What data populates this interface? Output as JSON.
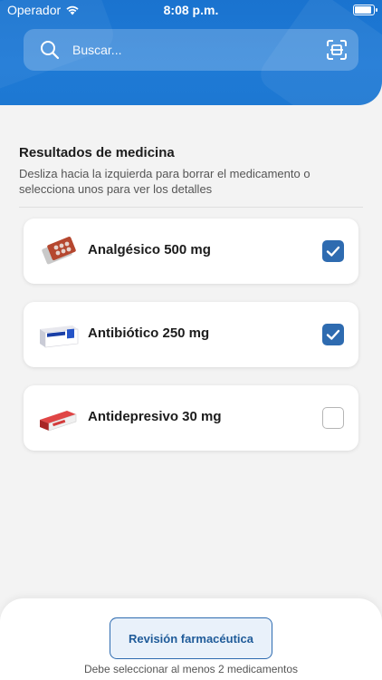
{
  "status_bar": {
    "carrier": "Operador",
    "time": "8:08 p.m."
  },
  "search": {
    "placeholder": "Buscar..."
  },
  "results": {
    "title": "Resultados de medicina",
    "subtitle": "Desliza hacia la izquierda para borrar el medicamento o selecciona unos para ver los detalles"
  },
  "medicines": [
    {
      "name": "Analgésico 500 mg",
      "checked": true,
      "icon": "pill-blister-icon"
    },
    {
      "name": "Antibiótico 250 mg",
      "checked": true,
      "icon": "medicine-box-icon"
    },
    {
      "name": "Antidepresivo 30 mg",
      "checked": false,
      "icon": "medicine-box-icon"
    }
  ],
  "footer": {
    "button_label": "Revisión farmacéutica",
    "hint": "Debe seleccionar al menos 2 medicamentos"
  },
  "colors": {
    "header": "#1a73cf",
    "accent": "#2e6bb0",
    "background": "#f3f3f3"
  }
}
